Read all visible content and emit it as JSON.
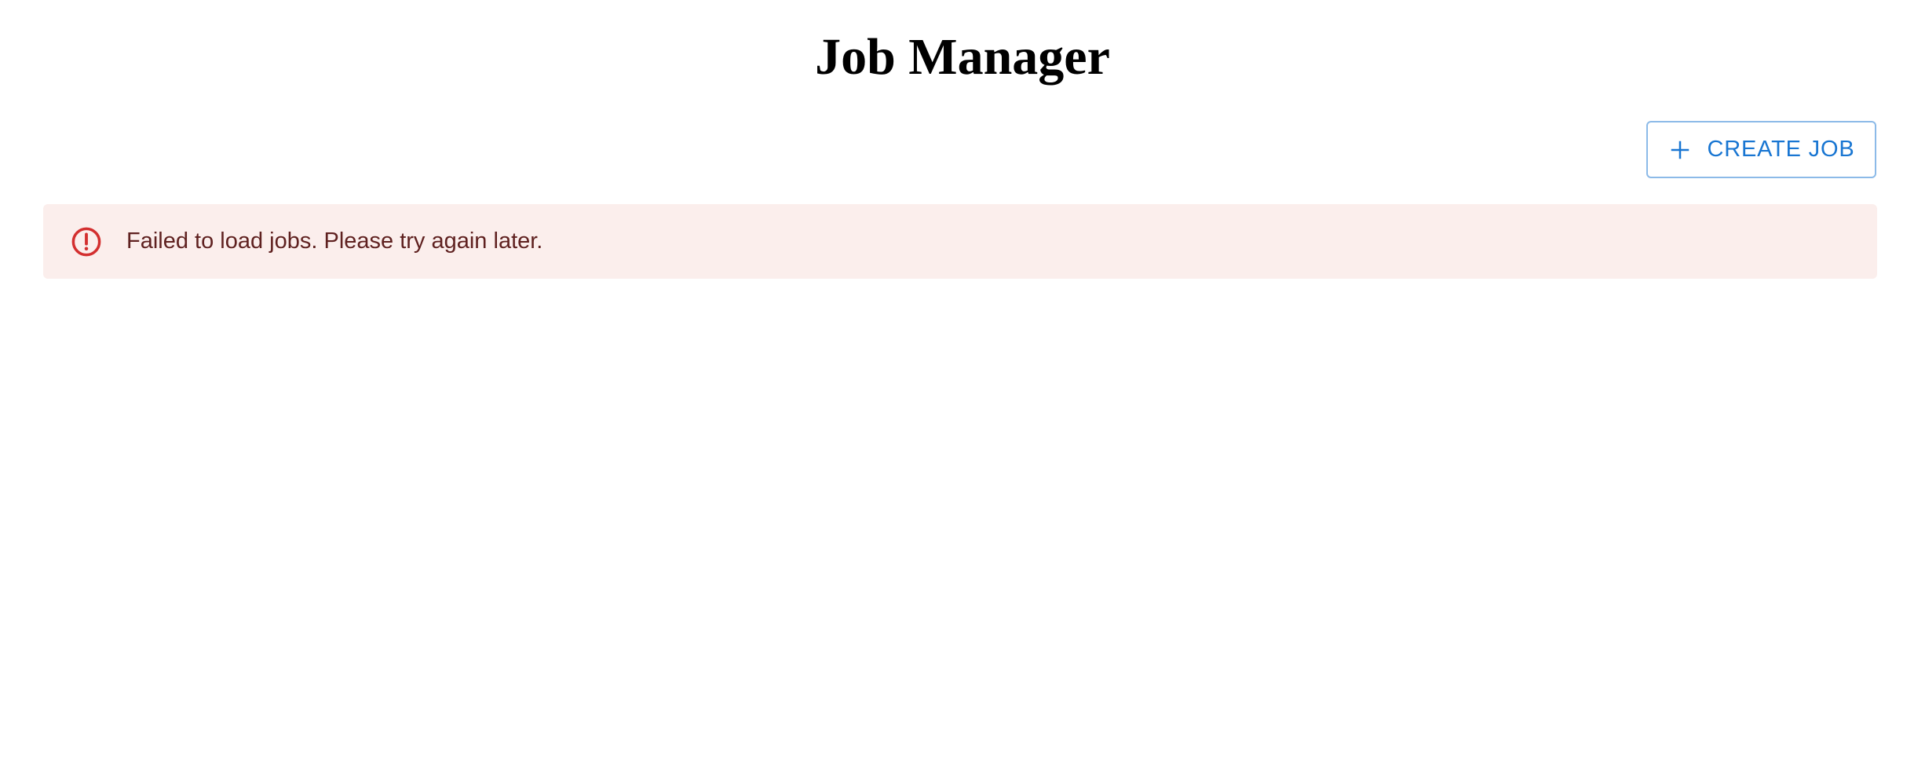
{
  "page": {
    "title": "Job Manager"
  },
  "toolbar": {
    "create_label": "CREATE JOB",
    "create_icon": "plus-icon",
    "accent_color": "#1976d2"
  },
  "alert": {
    "severity": "error",
    "icon": "error-outline-icon",
    "message": "Failed to load jobs. Please try again later.",
    "background_color": "#fbeeec",
    "icon_color": "#d32f2f",
    "text_color": "#5f2120"
  }
}
